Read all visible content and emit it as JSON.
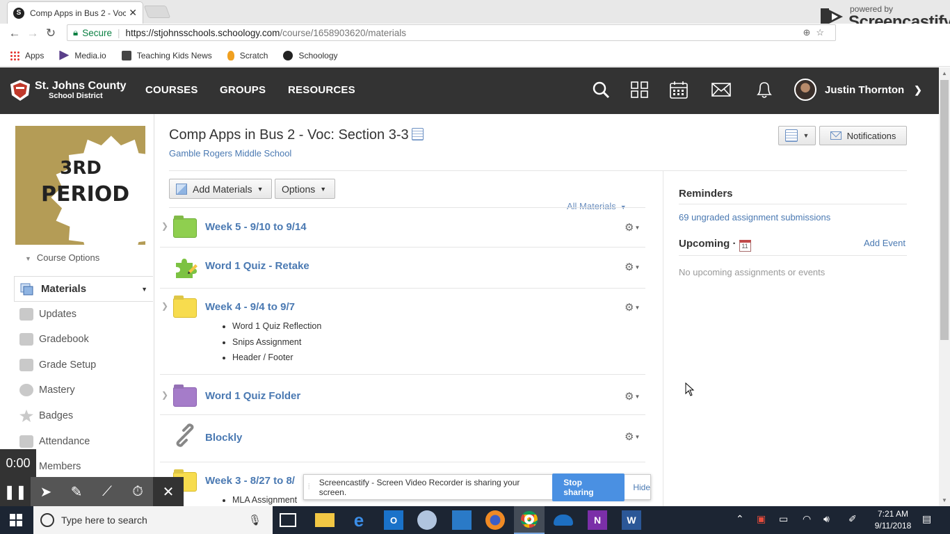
{
  "browser": {
    "tab_title": "Comp Apps in Bus 2 - Voc",
    "tab_favicon": "S",
    "secure_label": "Secure",
    "url_host": "https://stjohnsschools.schoology.com",
    "url_path": "/course/1658903620/materials",
    "bookmarks": [
      {
        "label": "Apps",
        "icon": "apps-grid-icon"
      },
      {
        "label": "Media.io",
        "icon": "media-io-icon"
      },
      {
        "label": "Teaching Kids News",
        "icon": "tkn-icon"
      },
      {
        "label": "Scratch",
        "icon": "scratch-icon"
      },
      {
        "label": "Schoology",
        "icon": "schoology-icon"
      }
    ],
    "screencastify_powered": "powered by",
    "screencastify_name": "Screencastify"
  },
  "header": {
    "district_line1": "St. Johns County",
    "district_line2": "School District",
    "nav": [
      "COURSES",
      "GROUPS",
      "RESOURCES"
    ],
    "user_name": "Justin Thornton"
  },
  "sidebar": {
    "profile_line1": "3RD",
    "profile_line2": "PERIOD",
    "course_options": "Course Options",
    "active": "Materials",
    "items": [
      "Updates",
      "Gradebook",
      "Grade Setup",
      "Mastery",
      "Badges",
      "Attendance",
      "Members"
    ]
  },
  "course": {
    "title": "Comp Apps in Bus 2 - Voc: Section 3-3",
    "school": "Gamble Rogers Middle School",
    "notifications_label": "Notifications",
    "add_materials_label": "Add Materials",
    "options_label": "Options",
    "filter_label": "All Materials"
  },
  "materials": [
    {
      "title": "Week 5 - 9/10 to 9/14",
      "icon": "folder-green-icon",
      "children": []
    },
    {
      "title": "Word 1 Quiz - Retake",
      "icon": "puzzle-assessment-icon",
      "children": []
    },
    {
      "title": "Week 4 - 9/4 to 9/7",
      "icon": "folder-yellow-icon",
      "children": [
        "Word 1 Quiz Reflection",
        "Snips Assignment",
        "Header / Footer"
      ]
    },
    {
      "title": "Word 1 Quiz Folder",
      "icon": "folder-purple-icon",
      "children": []
    },
    {
      "title": "Blockly",
      "icon": "link-icon",
      "children": []
    },
    {
      "title": "Week 3 - 8/27 to 8/",
      "icon": "folder-yellow-icon",
      "children": [
        "MLA Assignment"
      ]
    }
  ],
  "right": {
    "reminders_heading": "Reminders",
    "reminder_link": "69 ungraded assignment submissions",
    "upcoming_heading": "Upcoming ·",
    "calendar_day": "11",
    "add_event": "Add Event",
    "empty_text": "No upcoming assignments or events"
  },
  "recorder": {
    "timer": "0:00",
    "share_message": "Screencastify - Screen Video Recorder is sharing your screen.",
    "stop_label": "Stop sharing",
    "hide_label": "Hide"
  },
  "taskbar": {
    "search_placeholder": "Type here to search",
    "time": "7:21 AM",
    "date": "9/11/2018"
  },
  "colors": {
    "link": "#4a79b2",
    "header_bg": "#333333",
    "stop_button": "#4a90e2",
    "taskbar_bg": "#1c2533"
  }
}
